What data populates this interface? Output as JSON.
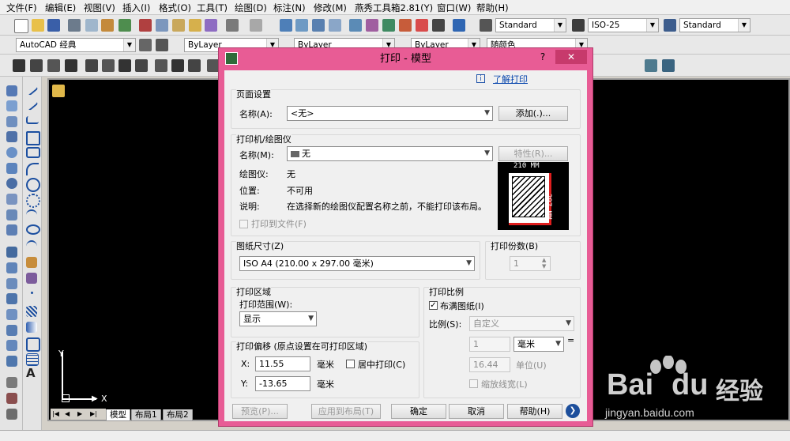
{
  "menu": [
    "文件(F)",
    "编辑(E)",
    "视图(V)",
    "插入(I)",
    "格式(O)",
    "工具(T)",
    "绘图(D)",
    "标注(N)",
    "修改(M)",
    "燕秀工具箱2.81(Y)",
    "窗口(W)",
    "帮助(H)"
  ],
  "toolbar": {
    "text_style": "Standard",
    "dim_style": "ISO-25",
    "table_style": "Standard",
    "workspace": "AutoCAD 经典",
    "layer": "ByLayer",
    "linetype": "ByLayer",
    "lineweight": "ByLayer",
    "color": "随颜色"
  },
  "canvas": {
    "axis_y": "Y",
    "axis_x": "X",
    "tabs": [
      "模型",
      "布局1",
      "布局2"
    ]
  },
  "dialog": {
    "title": "打印 - 模型",
    "help_btn": "?",
    "close_btn": "✕",
    "learn_link": "了解打印",
    "page_setup": {
      "title": "页面设置",
      "name_label": "名称(A):",
      "name_value": "<无>",
      "add_button": "添加(.)..."
    },
    "printer": {
      "title": "打印机/绘图仪",
      "name_label": "名称(M):",
      "name_value": "无",
      "props_button": "特性(R)...",
      "plotter_label": "绘图仪:",
      "plotter_value": "无",
      "location_label": "位置:",
      "location_value": "不可用",
      "desc_label": "说明:",
      "desc_value": "在选择新的绘图仪配置名称之前，不能打印该布局。",
      "print_to_file": "打印到文件(F)",
      "preview_width": "210 MM",
      "preview_height": "297 MM"
    },
    "paper": {
      "title": "图纸尺寸(Z)",
      "value": "ISO A4 (210.00 x 297.00 毫米)"
    },
    "copies": {
      "title": "打印份数(B)",
      "value": "1"
    },
    "area": {
      "title": "打印区域",
      "range_label": "打印范围(W):",
      "range_value": "显示"
    },
    "offset": {
      "title": "打印偏移 (原点设置在可打印区域)",
      "x_label": "X:",
      "x_value": "11.55",
      "x_unit": "毫米",
      "y_label": "Y:",
      "y_value": "-13.65",
      "y_unit": "毫米",
      "center_label": "居中打印(C)"
    },
    "scale": {
      "title": "打印比例",
      "fit_label": "布满图纸(I)",
      "scale_label": "比例(S):",
      "scale_value": "自定义",
      "num_value": "1",
      "unit_value": "毫米",
      "equals": "=",
      "den_value": "16.44",
      "unit_label": "单位(U)",
      "lineweight_label": "缩放线宽(L)"
    },
    "buttons": {
      "preview": "预览(P)...",
      "apply": "应用到布局(T)",
      "ok": "确定",
      "cancel": "取消",
      "help": "帮助(H)"
    }
  },
  "watermark": {
    "brand": "Bai",
    "brand_suffix": "du",
    "brand_cn": "经验",
    "url": "jingyan.baidu.com"
  }
}
